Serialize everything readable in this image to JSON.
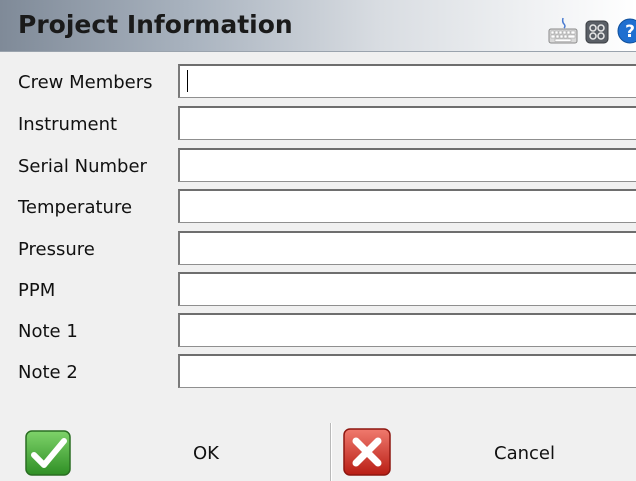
{
  "window": {
    "title": "Project Information"
  },
  "toolbar_icons": [
    "keyboard-icon",
    "grid-icon",
    "help-icon"
  ],
  "fields": [
    {
      "label": "Crew Members",
      "value": ""
    },
    {
      "label": "Instrument",
      "value": ""
    },
    {
      "label": "Serial Number",
      "value": ""
    },
    {
      "label": "Temperature",
      "value": ""
    },
    {
      "label": "Pressure",
      "value": ""
    },
    {
      "label": "PPM",
      "value": ""
    },
    {
      "label": "Note 1",
      "value": ""
    },
    {
      "label": "Note 2",
      "value": ""
    }
  ],
  "buttons": {
    "ok_label": "OK",
    "cancel_label": "Cancel"
  },
  "colors": {
    "ok_green": "#3aa12e",
    "cancel_red": "#d42a20",
    "help_blue": "#1f6fd0"
  }
}
